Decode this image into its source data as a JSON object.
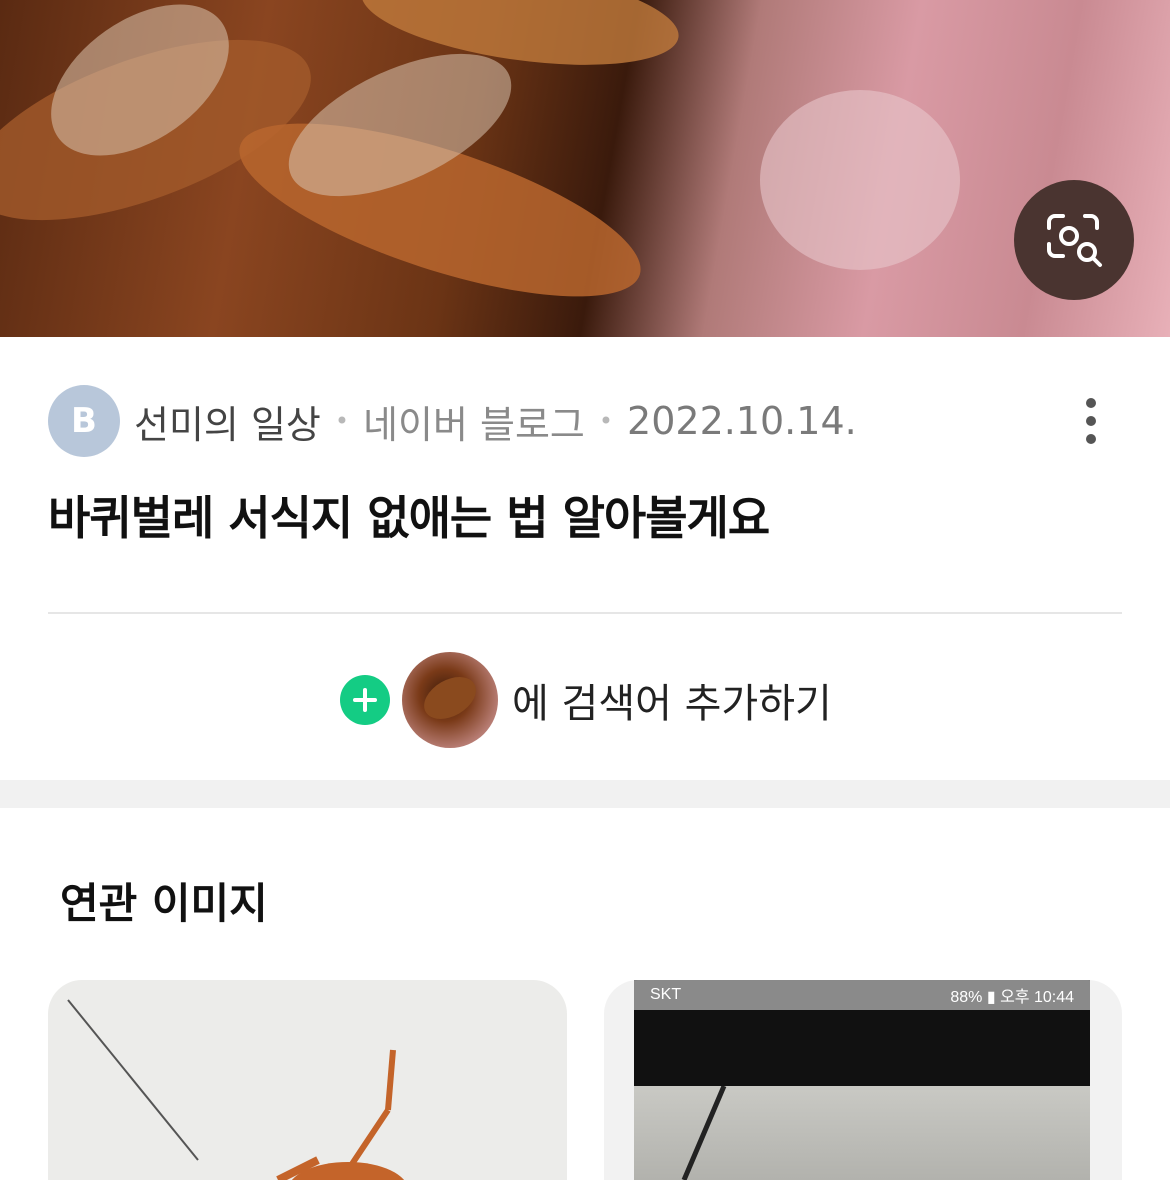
{
  "post": {
    "avatar_letter": "B",
    "blog_name": "선미의 일상",
    "source": "네이버 블로그",
    "date": "2022.10.14.",
    "separator": "•",
    "title": "바퀴벌레 서식지 없애는 법 알아볼게요"
  },
  "search_add": {
    "label": "에 검색어 추가하기"
  },
  "related": {
    "title": "연관 이미지",
    "cards": [
      {
        "kind": "photo"
      },
      {
        "kind": "screenshot",
        "carrier": "SKT",
        "status_right": "88% ▮ 오후 10:44"
      }
    ]
  },
  "icons": {
    "lens": "lens-search-icon",
    "more": "more-vertical-icon",
    "plus": "plus-icon"
  },
  "colors": {
    "accent_green": "#14cc84",
    "lens_button": "#4a3430",
    "band": "#f1f1f1"
  }
}
